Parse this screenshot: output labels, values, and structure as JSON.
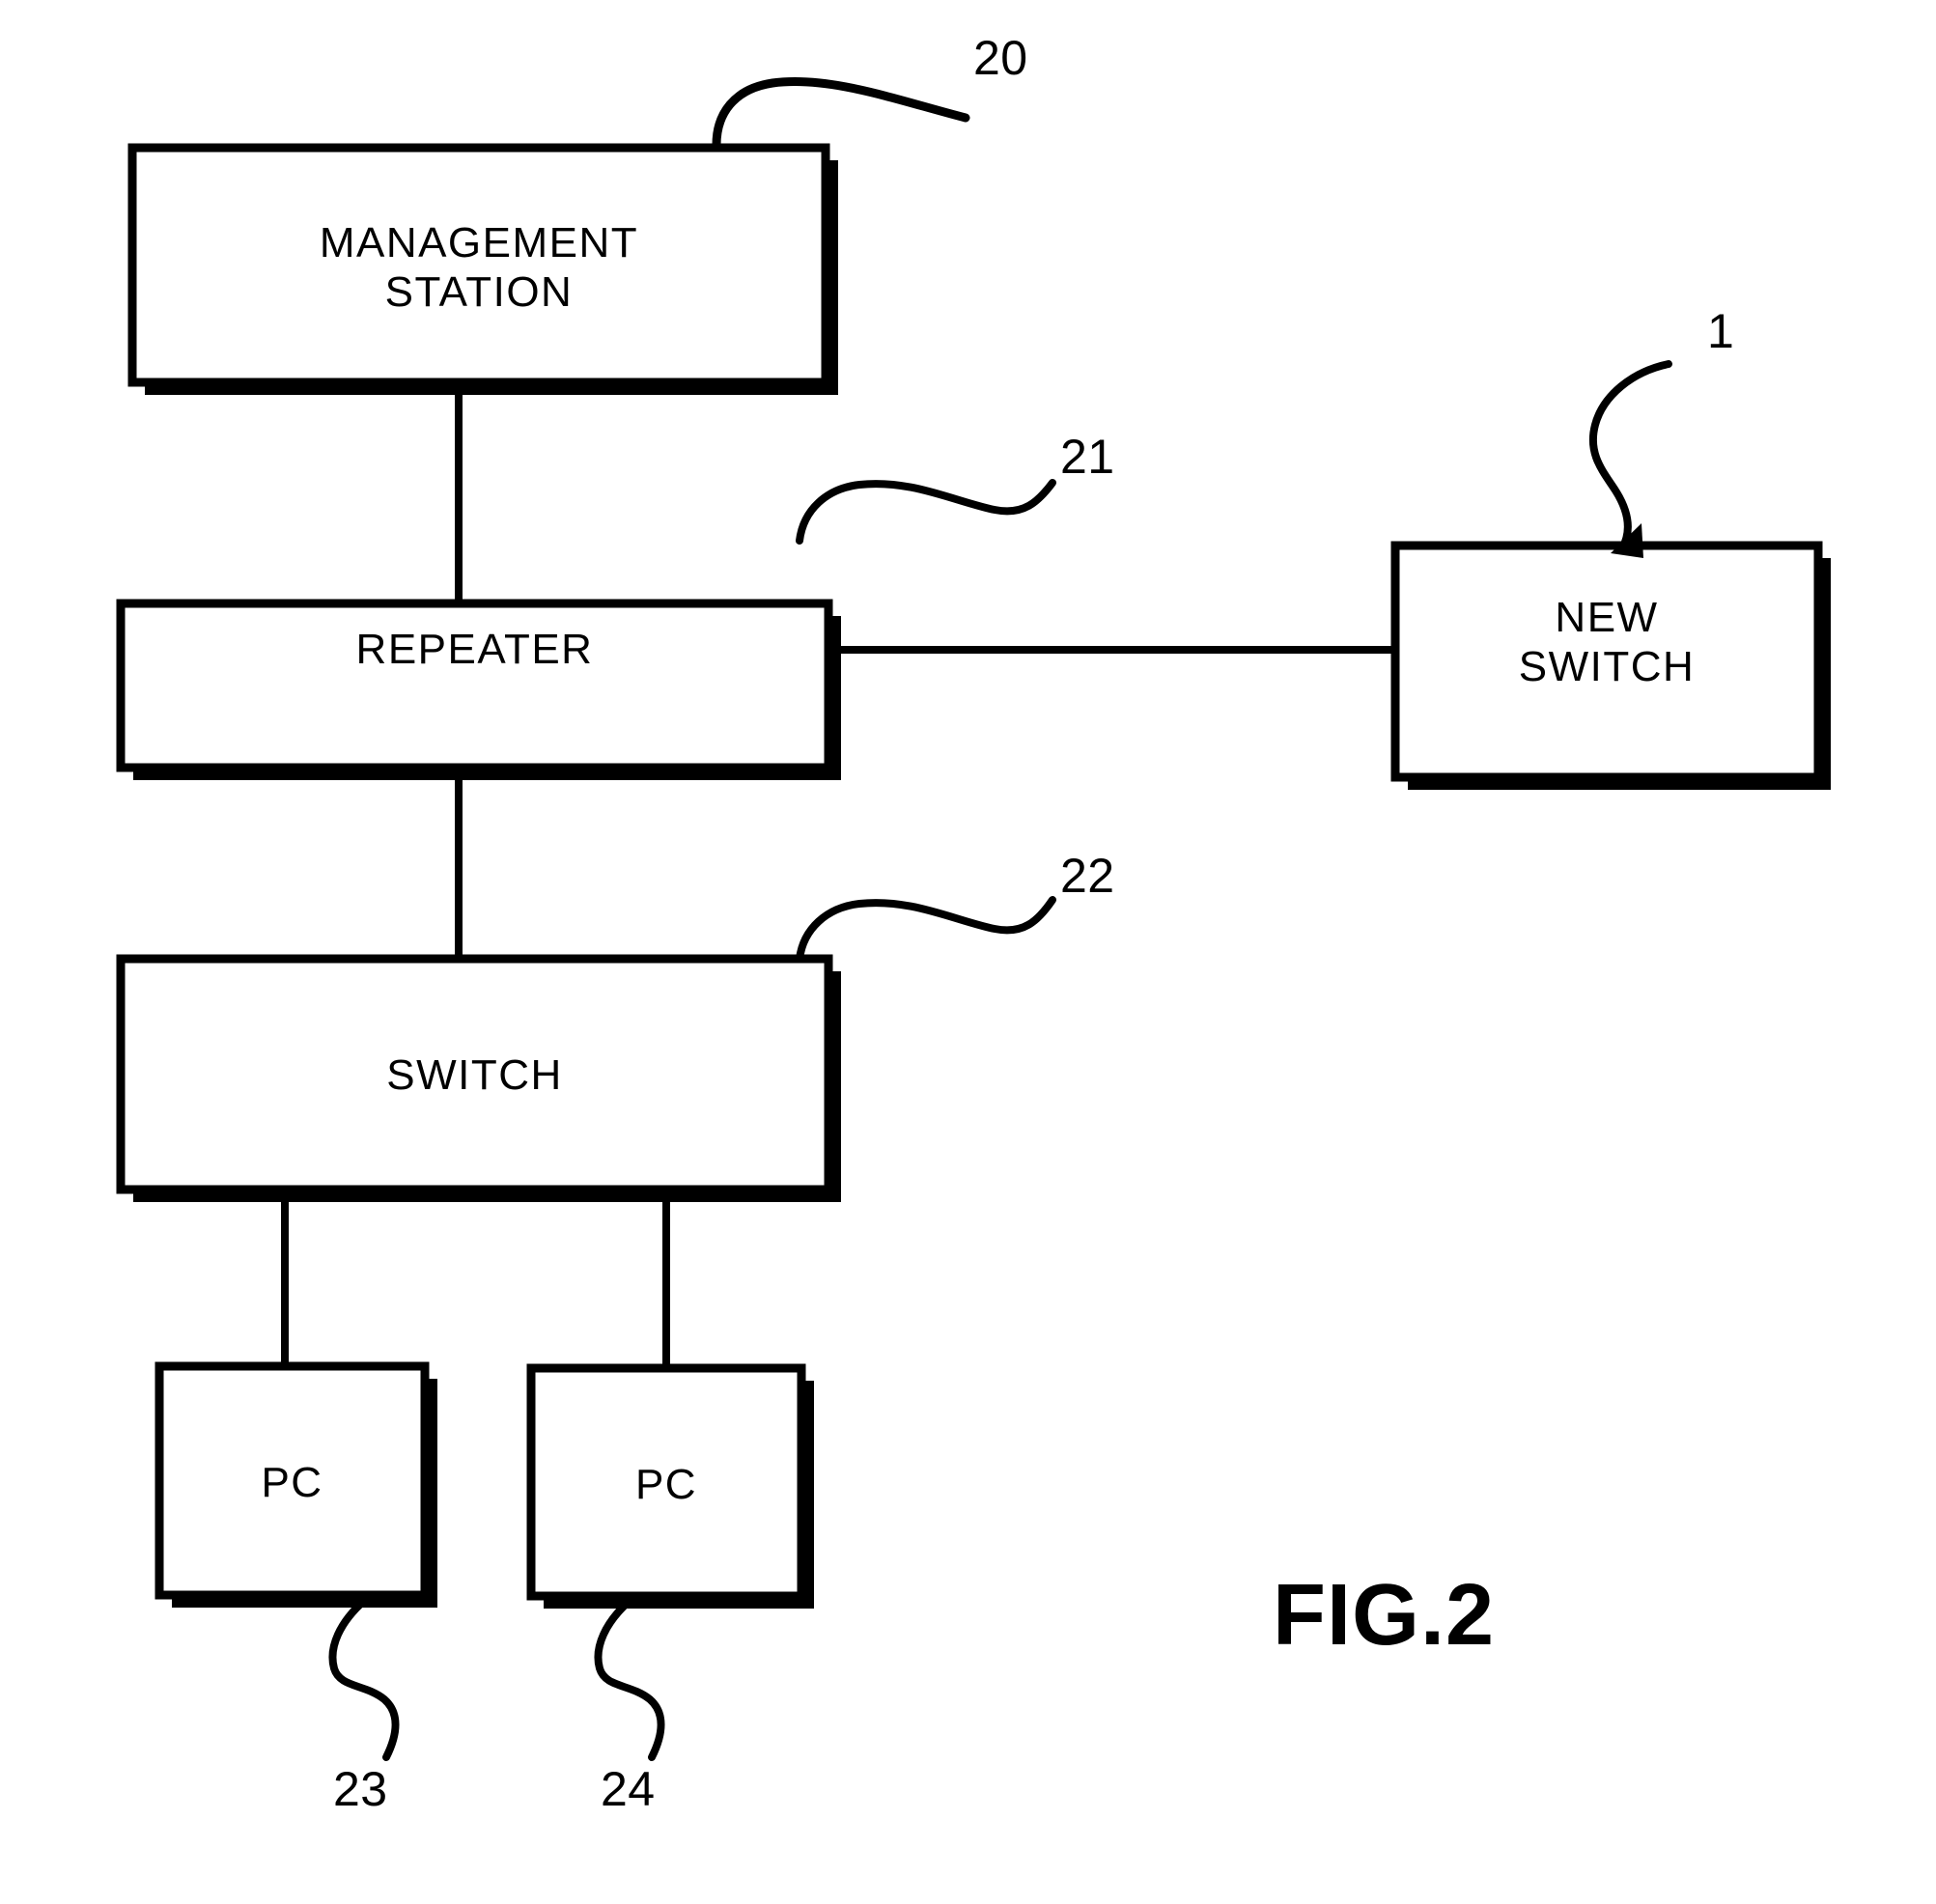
{
  "figure": {
    "caption": "FIG.2",
    "nodes": [
      {
        "id": "management-station",
        "label": "MANAGEMENT\nSTATION",
        "ref": "20"
      },
      {
        "id": "repeater",
        "label": "REPEATER",
        "ref": "21"
      },
      {
        "id": "new-switch",
        "label": "NEW\nSWITCH",
        "ref": "1"
      },
      {
        "id": "switch",
        "label": "SWITCH",
        "ref": "22"
      },
      {
        "id": "pc-left",
        "label": "PC",
        "ref": "23"
      },
      {
        "id": "pc-right",
        "label": "PC",
        "ref": "24"
      }
    ],
    "reference_numerals": {
      "management_station": "20",
      "repeater": "21",
      "new_switch": "1",
      "switch": "22",
      "pc_left": "23",
      "pc_right": "24"
    },
    "connections": [
      {
        "from": "management-station",
        "to": "repeater"
      },
      {
        "from": "repeater",
        "to": "new-switch"
      },
      {
        "from": "repeater",
        "to": "switch"
      },
      {
        "from": "switch",
        "to": "pc-left"
      },
      {
        "from": "switch",
        "to": "pc-right"
      }
    ],
    "colors": {
      "ink": "#000000",
      "paper": "#ffffff"
    }
  }
}
